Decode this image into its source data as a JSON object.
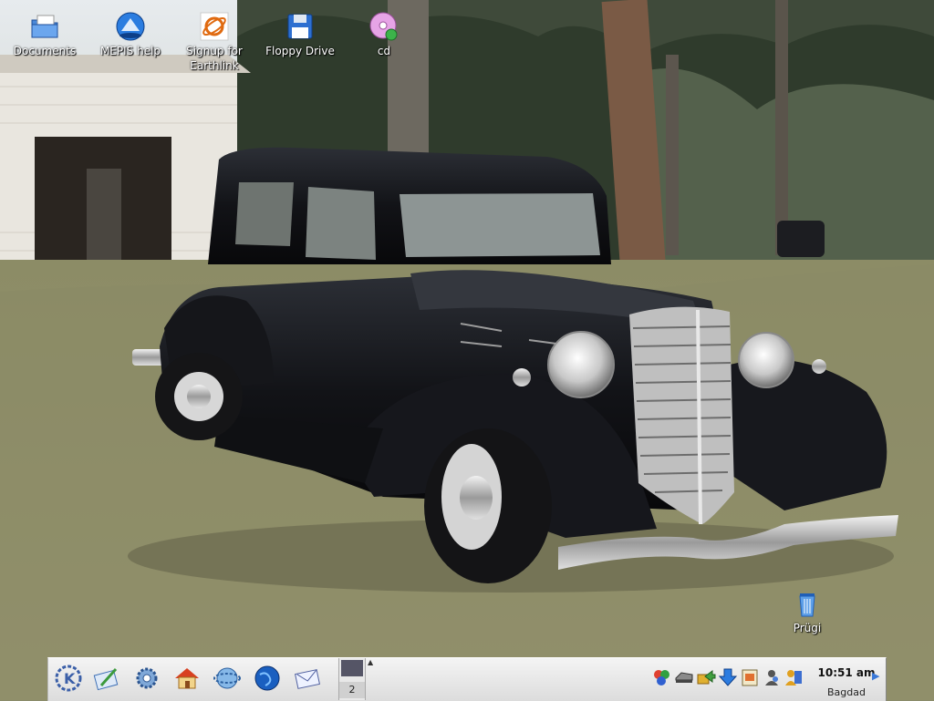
{
  "desktop": {
    "icons": [
      {
        "label": "Documents",
        "icon": "folder-documents-icon"
      },
      {
        "label": "MEPIS help",
        "icon": "help-globe-icon"
      },
      {
        "label": "Signup for Earthlink",
        "icon": "earthlink-icon"
      },
      {
        "label": "Floppy Drive",
        "icon": "floppy-icon"
      },
      {
        "label": "cd",
        "icon": "cd-icon"
      }
    ],
    "trash": {
      "label": "Prügi",
      "icon": "trash-icon"
    }
  },
  "panel": {
    "launchers": [
      "kde-menu-icon",
      "text-editor-icon",
      "settings-gear-icon",
      "home-icon",
      "web-browser-icon",
      "globe-icon",
      "mail-icon"
    ],
    "pager": {
      "current_desktop": "2"
    },
    "tray_icons": [
      "network-icon",
      "drive-icon",
      "update-icon",
      "download-arrow-icon",
      "clipboard-icon",
      "user-switch-icon",
      "keyboard-layout-icon"
    ],
    "clock": {
      "time": "10:51 am",
      "zone": "Bagdad"
    }
  },
  "colors": {
    "panel_bg": "#e6e6e6",
    "accent": "#3a78d8",
    "grass": "#8e8d68",
    "sky": "#dde4ea"
  }
}
